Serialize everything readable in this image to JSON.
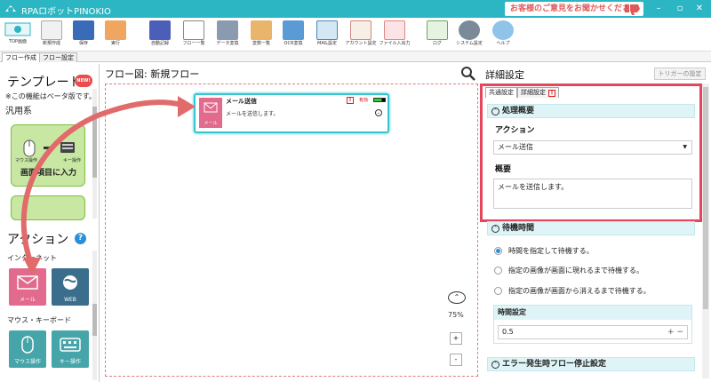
{
  "app": {
    "title": "RPAロボットPINOKIO",
    "feedback": "お客様のご意見をお聞かせください",
    "window_controls": [
      "–",
      "▫",
      "✕"
    ]
  },
  "toolbar": [
    {
      "label": "TOP画面"
    },
    {
      "label": "新規作成"
    },
    {
      "label": "保存"
    },
    {
      "label": "実行"
    },
    {
      "label": "自動記録"
    },
    {
      "label": "フロー一覧"
    },
    {
      "label": "データ変換"
    },
    {
      "label": "変数一覧"
    },
    {
      "label": "OCR変換"
    },
    {
      "label": "MAIL設定"
    },
    {
      "label": "アカウント設定"
    },
    {
      "label": "ファイル入出力"
    },
    {
      "label": "ログ"
    },
    {
      "label": "システム設定"
    },
    {
      "label": "ヘルプ"
    }
  ],
  "tabs": [
    {
      "label": "フロー作成"
    },
    {
      "label": "フロー設定"
    }
  ],
  "left": {
    "template_title": "テンプレート",
    "new_badge": "NEW!",
    "beta_note": "※この機能はベータ版です。",
    "general": "汎用系",
    "template_card": {
      "label": "画面項目に入力",
      "mouse": "マウス操作",
      "key": "キー操作"
    },
    "action_title": "アクション",
    "help_icon": "?",
    "internet": "インターネット",
    "mail_label": "メール",
    "web_label": "WEB",
    "mouse_keyboard": "マウス・キーボード",
    "mouse_label": "マウス操作",
    "key_label": "キー操作"
  },
  "flow": {
    "title": "フロー図:  新規フロー",
    "node": {
      "title": "メール送信",
      "desc": "メールを送信します。",
      "icon_label": "メール",
      "status": "有効",
      "warn": "!"
    },
    "zoom": "75%",
    "zoom_in": "+",
    "zoom_out": "-"
  },
  "right": {
    "title": "詳細設定",
    "trigger": "トリガーの設定",
    "tab_common": "共通設定",
    "tab_detail": "詳細設定",
    "tab_warn": "!",
    "section1": "処理概要",
    "action_label": "アクション",
    "action_value": "メール送信",
    "summary_label": "概要",
    "summary_value": "メールを送信します。",
    "section2": "待機時間",
    "radios": [
      {
        "label": "時間を指定して待機する。",
        "selected": true
      },
      {
        "label": "指定の画像が画面に現れるまで待機する。",
        "selected": false
      },
      {
        "label": "指定の画像が画面から消えるまで待機する。",
        "selected": false
      }
    ],
    "time_label": "時間設定",
    "time_value": "0.5",
    "time_pm": "+ −",
    "section3": "エラー発生時フロー停止設定"
  },
  "colors": {
    "titlebar": "#2cb5c2",
    "highlight": "#e5465b",
    "mail": "#e16a8d",
    "web": "#3a6e8c",
    "teal_action": "#45a5a8",
    "template_green": "#c7e7a3"
  }
}
